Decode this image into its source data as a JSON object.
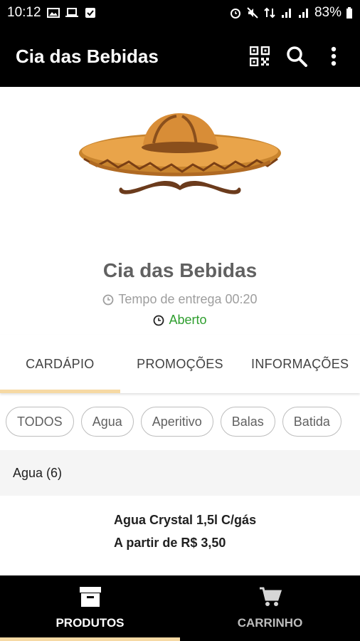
{
  "status_bar": {
    "time": "10:12",
    "battery": "83%",
    "left_icons": [
      "image-icon",
      "laptop-icon",
      "check-icon"
    ],
    "right_icons": [
      "alarm-icon",
      "mute-icon",
      "data-icon",
      "signal-icon",
      "signal-icon",
      "battery-icon"
    ]
  },
  "app_bar": {
    "title": "Cia das Bebidas",
    "actions": [
      "qr-code-icon",
      "search-icon",
      "more-vertical-icon"
    ]
  },
  "store": {
    "name": "Cia das Bebidas",
    "delivery_time": "Tempo de entrega 00:20",
    "status": "Aberto",
    "logo": "sombrero-mustache-logo"
  },
  "tabs": [
    {
      "label": "CARDÁPIO",
      "active": true
    },
    {
      "label": "PROMOÇÕES",
      "active": false
    },
    {
      "label": "INFORMAÇÕES",
      "active": false
    }
  ],
  "filters": [
    "TODOS",
    "Agua",
    "Aperitivo",
    "Balas",
    "Batida"
  ],
  "category": {
    "label": "Agua (6)"
  },
  "product": {
    "name": "Agua Crystal 1,5l C/gás",
    "price": "A partir de R$ 3,50"
  },
  "bottom_nav": [
    {
      "label": "PRODUTOS",
      "icon": "archive-box-icon",
      "active": true
    },
    {
      "label": "CARRINHO",
      "icon": "shopping-cart-icon",
      "active": false
    }
  ],
  "colors": {
    "bar_background": "#000000",
    "accent_underline": "#f6d9a4",
    "open_status": "#2e9e2e",
    "muted_text": "#9e9e9e"
  }
}
